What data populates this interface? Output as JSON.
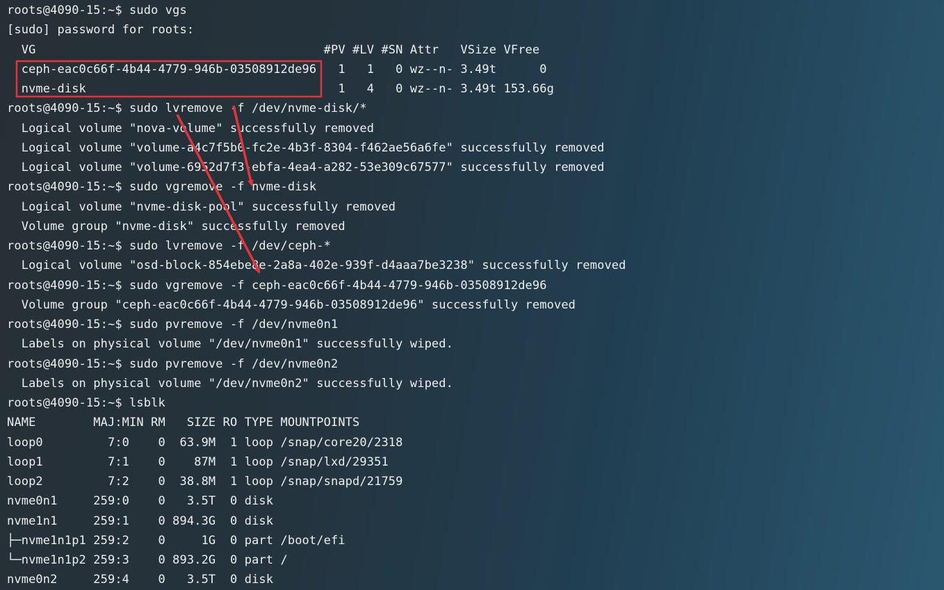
{
  "terminal": {
    "lines": [
      "roots@4090-15:~$ sudo vgs",
      "[sudo] password for roots:",
      "  VG                                        #PV #LV #SN Attr   VSize VFree",
      "  ceph-eac0c66f-4b44-4779-946b-03508912de96   1   1   0 wz--n- 3.49t      0",
      "  nvme-disk                                   1   4   0 wz--n- 3.49t 153.66g",
      "roots@4090-15:~$ sudo lvremove -f /dev/nvme-disk/*",
      "  Logical volume \"nova-volume\" successfully removed",
      "  Logical volume \"volume-a4c7f5b0-fc2e-4b3f-8304-f462ae56a6fe\" successfully removed",
      "  Logical volume \"volume-6952d7f3-ebfa-4ea4-a282-53e309c67577\" successfully removed",
      "roots@4090-15:~$ sudo vgremove -f nvme-disk",
      "  Logical volume \"nvme-disk-pool\" successfully removed",
      "  Volume group \"nvme-disk\" successfully removed",
      "roots@4090-15:~$ sudo lvremove -f /dev/ceph-*",
      "  Logical volume \"osd-block-854ebe8e-2a8a-402e-939f-d4aaa7be3238\" successfully removed",
      "roots@4090-15:~$ sudo vgremove -f ceph-eac0c66f-4b44-4779-946b-03508912de96",
      "  Volume group \"ceph-eac0c66f-4b44-4779-946b-03508912de96\" successfully removed",
      "roots@4090-15:~$ sudo pvremove -f /dev/nvme0n1",
      "  Labels on physical volume \"/dev/nvme0n1\" successfully wiped.",
      "roots@4090-15:~$ sudo pvremove -f /dev/nvme0n2",
      "  Labels on physical volume \"/dev/nvme0n2\" successfully wiped.",
      "roots@4090-15:~$ lsblk",
      "NAME        MAJ:MIN RM   SIZE RO TYPE MOUNTPOINTS",
      "loop0         7:0    0  63.9M  1 loop /snap/core20/2318",
      "loop1         7:1    0    87M  1 loop /snap/lxd/29351",
      "loop2         7:2    0  38.8M  1 loop /snap/snapd/21759",
      "nvme0n1     259:0    0   3.5T  0 disk",
      "nvme1n1     259:1    0 894.3G  0 disk",
      "├─nvme1n1p1 259:2    0     1G  0 part /boot/efi",
      "└─nvme1n1p2 259:3    0 893.2G  0 part /",
      "nvme0n2     259:4    0   3.5T  0 disk"
    ]
  },
  "annotation_color": "#e4343a"
}
